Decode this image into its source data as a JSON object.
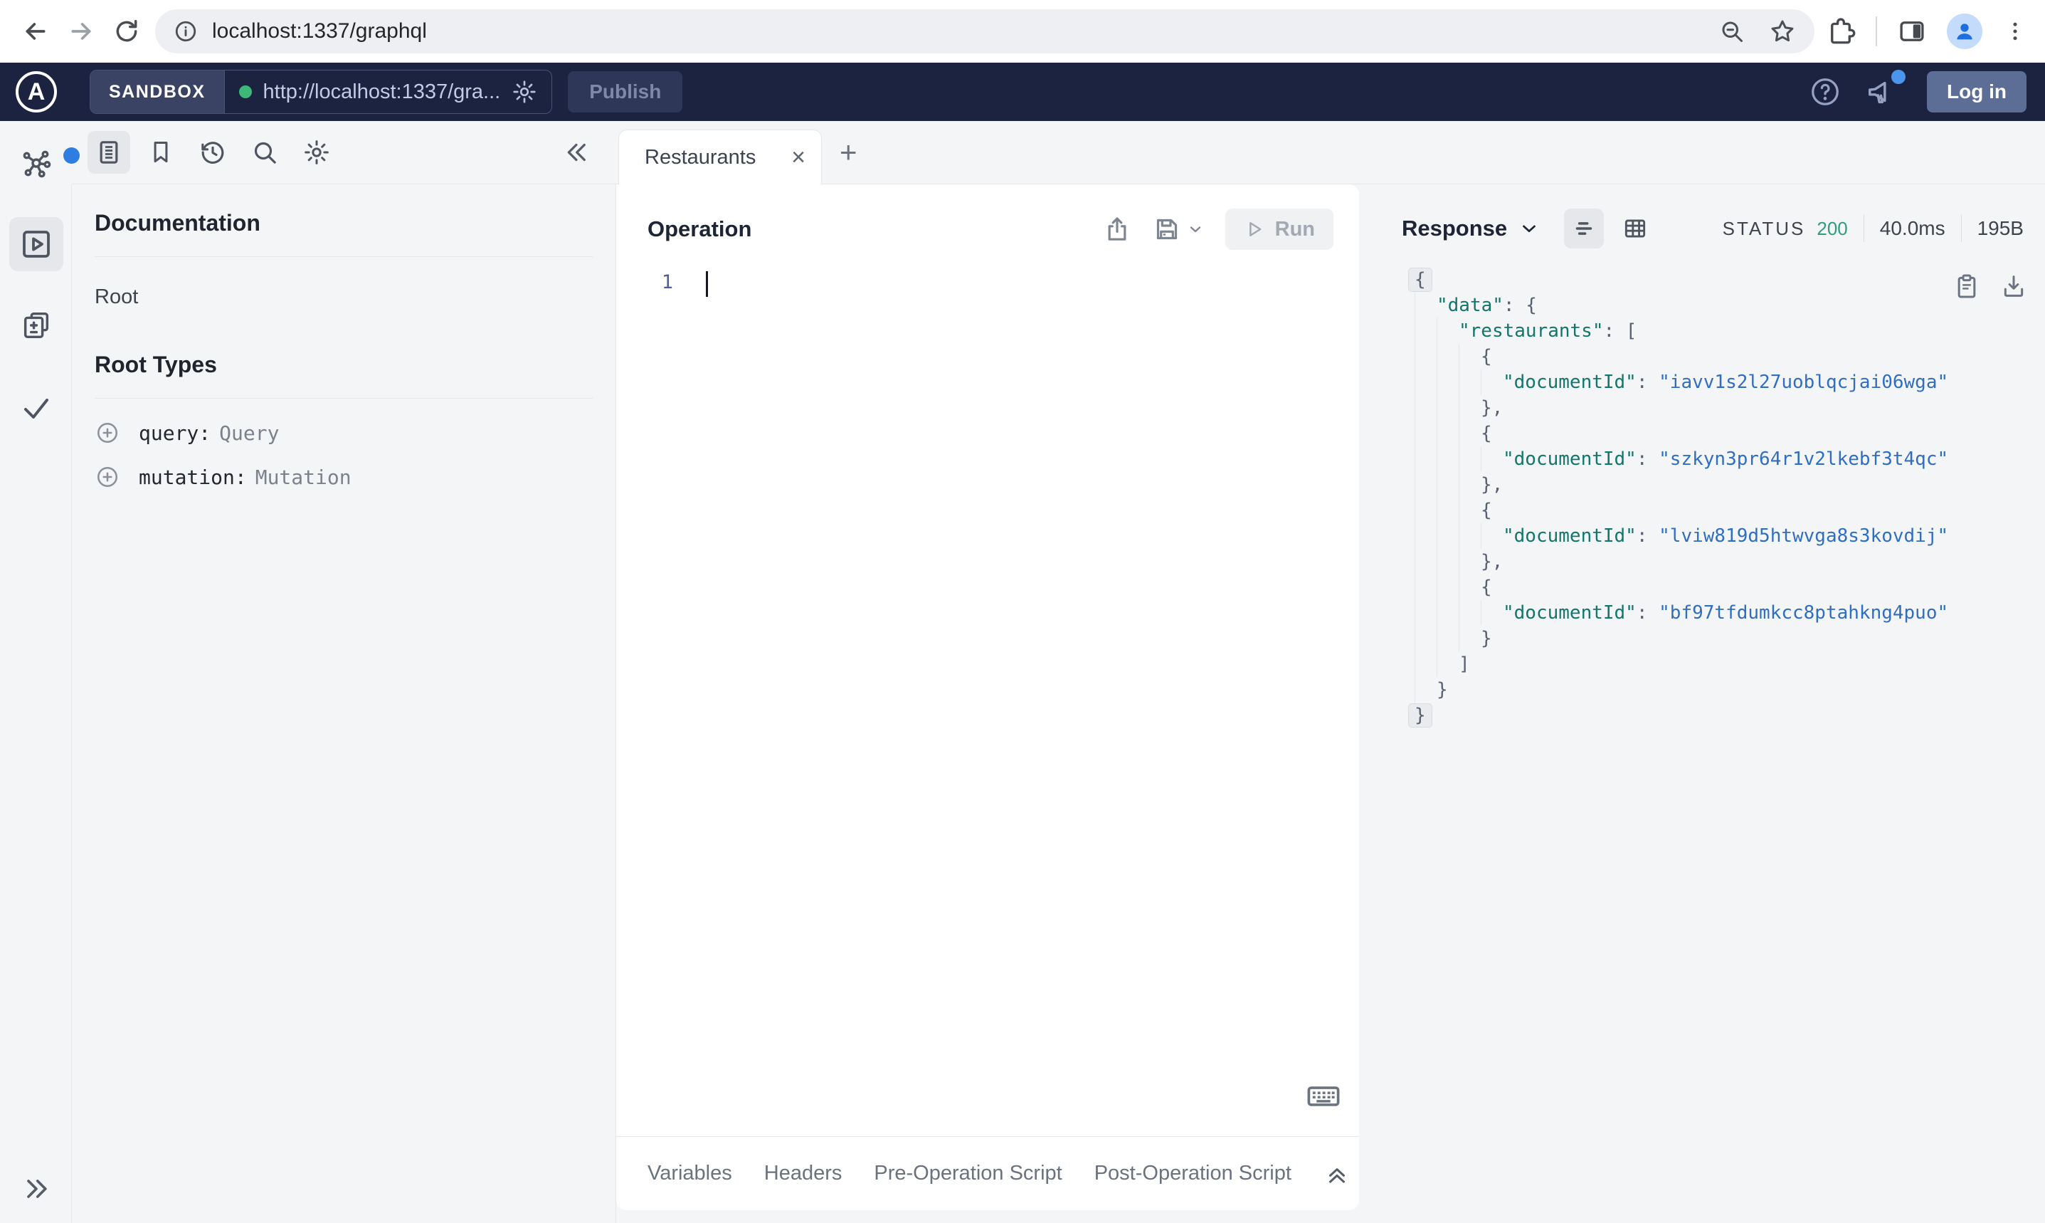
{
  "browser": {
    "url": "localhost:1337/graphql"
  },
  "sandbox_header": {
    "logo_letter": "A",
    "env_label": "SANDBOX",
    "endpoint_url": "http://localhost:1337/gra...",
    "publish_label": "Publish",
    "login_label": "Log in",
    "colors": {
      "header_bg": "#1b2340",
      "connected_dot": "#3cb878",
      "login_bg": "#5c6d96"
    }
  },
  "doc_panel": {
    "title": "Documentation",
    "root_link": "Root",
    "section_title": "Root Types",
    "root_types": [
      {
        "field": "query:",
        "type": "Query"
      },
      {
        "field": "mutation:",
        "type": "Mutation"
      }
    ]
  },
  "tabs": {
    "active_label": "Restaurants"
  },
  "icons": {
    "close_tab": "×",
    "new_tab": "+"
  },
  "operation": {
    "title": "Operation",
    "run_label": "Run",
    "line_number": "1"
  },
  "response": {
    "title": "Response",
    "status_label": "STATUS",
    "status_code": "200",
    "duration": "40.0ms",
    "size": "195B",
    "colors": {
      "key": "#12766b",
      "string": "#2f6ec2",
      "punctuation": "#586071",
      "status_green": "#2f9e77"
    },
    "lines": [
      {
        "indent": 0,
        "fold": true,
        "segs": [
          [
            "p",
            "{"
          ]
        ]
      },
      {
        "indent": 1,
        "segs": [
          [
            "k",
            "\"data\""
          ],
          [
            "p",
            ": {"
          ]
        ]
      },
      {
        "indent": 2,
        "segs": [
          [
            "k",
            "\"restaurants\""
          ],
          [
            "p",
            ": ["
          ]
        ]
      },
      {
        "indent": 3,
        "segs": [
          [
            "p",
            "{"
          ]
        ]
      },
      {
        "indent": 4,
        "segs": [
          [
            "k",
            "\"documentId\""
          ],
          [
            "p",
            ": "
          ],
          [
            "s",
            "\"iavv1s2l27uoblqcjai06wga\""
          ]
        ]
      },
      {
        "indent": 3,
        "segs": [
          [
            "p",
            "},"
          ]
        ]
      },
      {
        "indent": 3,
        "segs": [
          [
            "p",
            "{"
          ]
        ]
      },
      {
        "indent": 4,
        "segs": [
          [
            "k",
            "\"documentId\""
          ],
          [
            "p",
            ": "
          ],
          [
            "s",
            "\"szkyn3pr64r1v2lkebf3t4qc\""
          ]
        ]
      },
      {
        "indent": 3,
        "segs": [
          [
            "p",
            "},"
          ]
        ]
      },
      {
        "indent": 3,
        "segs": [
          [
            "p",
            "{"
          ]
        ]
      },
      {
        "indent": 4,
        "segs": [
          [
            "k",
            "\"documentId\""
          ],
          [
            "p",
            ": "
          ],
          [
            "s",
            "\"lviw819d5htwvga8s3kovdij\""
          ]
        ]
      },
      {
        "indent": 3,
        "segs": [
          [
            "p",
            "},"
          ]
        ]
      },
      {
        "indent": 3,
        "segs": [
          [
            "p",
            "{"
          ]
        ]
      },
      {
        "indent": 4,
        "segs": [
          [
            "k",
            "\"documentId\""
          ],
          [
            "p",
            ": "
          ],
          [
            "s",
            "\"bf97tfdumkcc8ptahkng4puo\""
          ]
        ]
      },
      {
        "indent": 3,
        "segs": [
          [
            "p",
            "}"
          ]
        ]
      },
      {
        "indent": 2,
        "segs": [
          [
            "p",
            "]"
          ]
        ]
      },
      {
        "indent": 1,
        "segs": [
          [
            "p",
            "}"
          ]
        ]
      },
      {
        "indent": 0,
        "fold": true,
        "segs": [
          [
            "p",
            "}"
          ]
        ]
      }
    ]
  },
  "bottom_bar": {
    "tabs": [
      "Variables",
      "Headers",
      "Pre-Operation Script",
      "Post-Operation Script"
    ]
  }
}
